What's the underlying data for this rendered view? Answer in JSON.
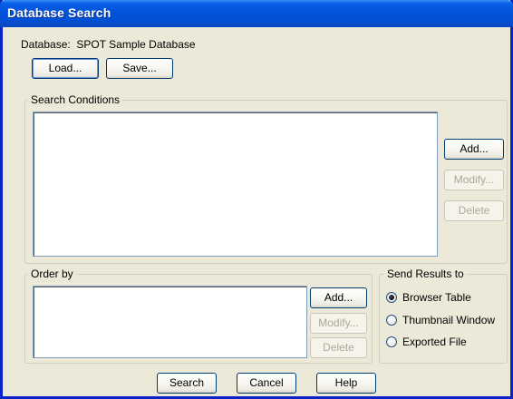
{
  "window": {
    "title": "Database Search"
  },
  "database": {
    "label": "Database:  SPOT Sample Database",
    "load_label": "Load...",
    "save_label": "Save..."
  },
  "search_conditions": {
    "label": "Search Conditions",
    "add_label": "Add...",
    "modify_label": "Modify...",
    "delete_label": "Delete"
  },
  "order_by": {
    "label": "Order by",
    "add_label": "Add...",
    "modify_label": "Modify...",
    "delete_label": "Delete"
  },
  "send_results": {
    "label": "Send Results to",
    "options": [
      {
        "label": "Browser Table",
        "checked": true
      },
      {
        "label": "Thumbnail Window",
        "checked": false
      },
      {
        "label": "Exported File",
        "checked": false
      }
    ]
  },
  "footer": {
    "search_label": "Search",
    "cancel_label": "Cancel",
    "help_label": "Help"
  },
  "colors": {
    "titlebar": "#0353DC",
    "face": "#ECE9D8",
    "disabled_text": "#ACA899"
  }
}
